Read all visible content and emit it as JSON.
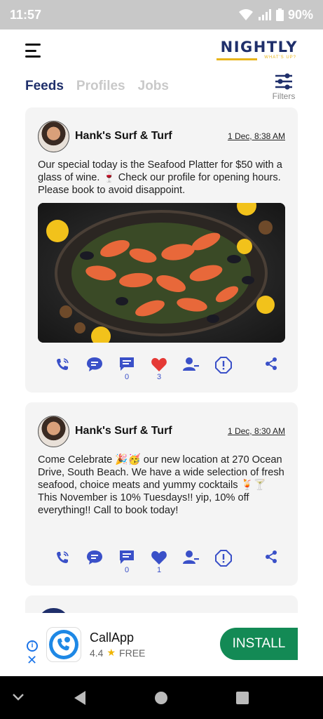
{
  "status_bar": {
    "time": "11:57",
    "battery": "90%"
  },
  "brand": {
    "name": "NIGHTLY",
    "tagline": "WHAT'S UP?"
  },
  "tabs": [
    {
      "label": "Feeds",
      "active": true
    },
    {
      "label": "Profiles",
      "active": false
    },
    {
      "label": "Jobs",
      "active": false
    }
  ],
  "filters_label": "Filters",
  "posts": [
    {
      "author": "Hank's Surf & Turf",
      "date": "1 Dec, 8:38 AM",
      "text": "Our special today is the Seafood Platter for $50 with a glass of wine. 🍷 Check our profile for opening hours. Please book to avoid disappoint.",
      "comments": "0",
      "likes": "3",
      "liked": true
    },
    {
      "author": "Hank's Surf & Turf",
      "date": "1 Dec, 8:30 AM",
      "text": "Come Celebrate 🎉🥳 our new location at 270 Ocean Drive, South Beach. We have a wide selection of fresh seafood, choice meats and yummy cocktails 🍹🍸 This November is 10% Tuesdays!! yip, 10% off everything!! Call to book today!",
      "comments": "0",
      "likes": "1",
      "liked": false
    }
  ],
  "ad": {
    "app_name": "CallApp",
    "rating": "4.4",
    "price": "FREE",
    "cta": "INSTALL"
  },
  "colors": {
    "brand": "#1f2f6b",
    "accent": "#3a50c8",
    "like": "#e53935",
    "install": "#138a55"
  }
}
